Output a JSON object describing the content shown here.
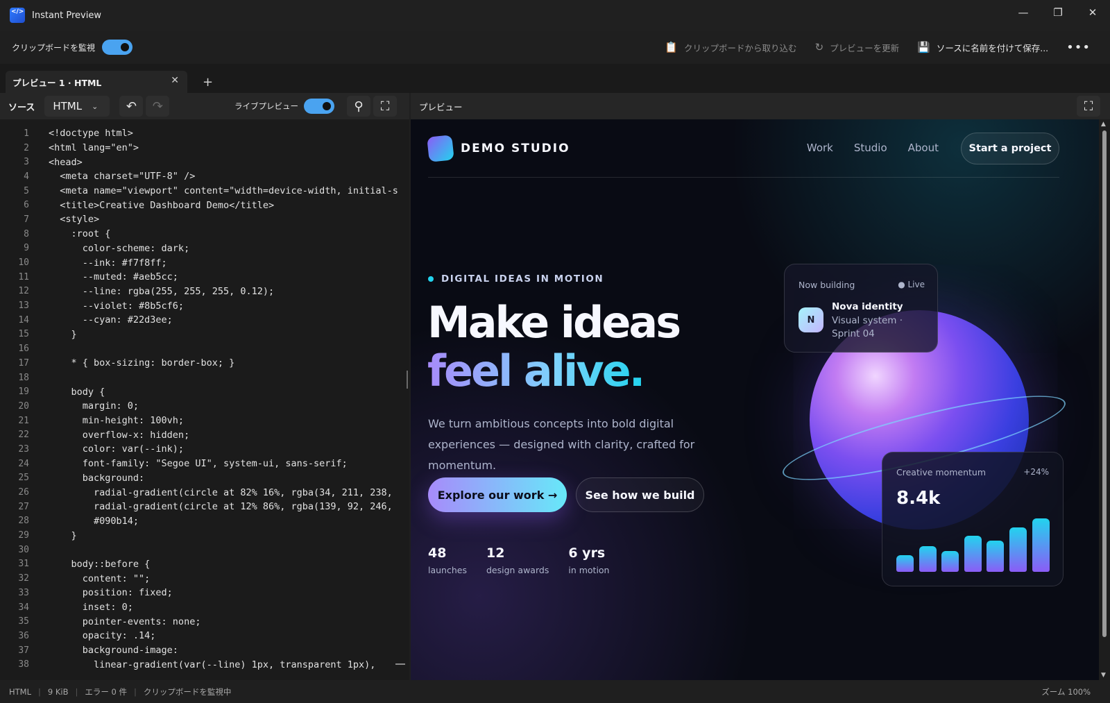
{
  "window": {
    "title": "Instant Preview",
    "controls": [
      "minimize-icon",
      "restore-icon",
      "close-icon"
    ]
  },
  "toolbar": {
    "monitor_label": "クリップボードを監視",
    "monitor_on": true,
    "import_label": "クリップボードから取り込む",
    "refresh_label": "プレビューを更新",
    "save_label": "ソースに名前を付けて保存..."
  },
  "tabs": [
    {
      "label": "プレビュー 1 · HTML",
      "active": true
    }
  ],
  "editor": {
    "source_label": "ソース",
    "language": "HTML",
    "live_preview_label": "ライブプレビュー",
    "live_preview_on": true,
    "lines": [
      {
        "n": "1",
        "text": "<!doctype html>"
      },
      {
        "n": "2",
        "text": "<html lang=\"en\">"
      },
      {
        "n": "3",
        "text": "<head>"
      },
      {
        "n": "4",
        "text": "  <meta charset=\"UTF-8\" />"
      },
      {
        "n": "5",
        "text": "  <meta name=\"viewport\" content=\"width=device-width, initial-s"
      },
      {
        "n": "6",
        "text": "  <title>Creative Dashboard Demo</title>"
      },
      {
        "n": "7",
        "text": "  <style>"
      },
      {
        "n": "8",
        "text": "    :root {"
      },
      {
        "n": "9",
        "text": "      color-scheme: dark;"
      },
      {
        "n": "10",
        "text": "      --ink: #f7f8ff;"
      },
      {
        "n": "11",
        "text": "      --muted: #aeb5cc;"
      },
      {
        "n": "12",
        "text": "      --line: rgba(255, 255, 255, 0.12);"
      },
      {
        "n": "13",
        "text": "      --violet: #8b5cf6;"
      },
      {
        "n": "14",
        "text": "      --cyan: #22d3ee;"
      },
      {
        "n": "15",
        "text": "    }"
      },
      {
        "n": "16",
        "text": ""
      },
      {
        "n": "17",
        "text": "    * { box-sizing: border-box; }"
      },
      {
        "n": "18",
        "text": ""
      },
      {
        "n": "19",
        "text": "    body {"
      },
      {
        "n": "20",
        "text": "      margin: 0;"
      },
      {
        "n": "21",
        "text": "      min-height: 100vh;"
      },
      {
        "n": "22",
        "text": "      overflow-x: hidden;"
      },
      {
        "n": "23",
        "text": "      color: var(--ink);"
      },
      {
        "n": "24",
        "text": "      font-family: \"Segoe UI\", system-ui, sans-serif;"
      },
      {
        "n": "25",
        "text": "      background:"
      },
      {
        "n": "26",
        "text": "        radial-gradient(circle at 82% 16%, rgba(34, 211, 238,"
      },
      {
        "n": "27",
        "text": "        radial-gradient(circle at 12% 86%, rgba(139, 92, 246,"
      },
      {
        "n": "28",
        "text": "        #090b14;"
      },
      {
        "n": "29",
        "text": "    }"
      },
      {
        "n": "30",
        "text": ""
      },
      {
        "n": "31",
        "text": "    body::before {"
      },
      {
        "n": "32",
        "text": "      content: \"\";"
      },
      {
        "n": "33",
        "text": "      position: fixed;"
      },
      {
        "n": "34",
        "text": "      inset: 0;"
      },
      {
        "n": "35",
        "text": "      pointer-events: none;"
      },
      {
        "n": "36",
        "text": "      opacity: .14;"
      },
      {
        "n": "37",
        "text": "      background-image:"
      },
      {
        "n": "38",
        "text": "        linear-gradient(var(--line) 1px, transparent 1px),"
      }
    ]
  },
  "preview": {
    "label": "プレビュー",
    "site": {
      "brand": "DEMO STUDIO",
      "nav": [
        "Work",
        "Studio",
        "About"
      ],
      "cta": "Start a project",
      "eyebrow": "DIGITAL IDEAS IN MOTION",
      "headline_1": "Make ideas",
      "headline_2": "feel alive.",
      "lead": "We turn ambitious concepts into bold digital experiences — designed with clarity, crafted for momentum.",
      "btn_primary": "Explore our work →",
      "btn_secondary": "See how we build",
      "stats": [
        {
          "value": "48",
          "label": "launches"
        },
        {
          "value": "12",
          "label": "design awards"
        },
        {
          "value": "6 yrs",
          "label": "in motion"
        }
      ],
      "now_card": {
        "title": "Now building",
        "status": "● Live",
        "avatar": "N",
        "name": "Nova identity",
        "sub": "Visual system · Sprint 04"
      },
      "momentum_card": {
        "title": "Creative momentum",
        "delta": "+24%",
        "value": "8.4k",
        "bars": [
          0.28,
          0.44,
          0.36,
          0.62,
          0.53,
          0.76,
          0.92
        ]
      }
    }
  },
  "status_bar": {
    "language": "HTML",
    "size": "9 KiB",
    "errors": "エラー 0 件",
    "clipboard": "クリップボードを監視中",
    "zoom": "ズーム 100%"
  },
  "colors": {
    "accent": "#4aa3f0",
    "ink": "#f7f8ff",
    "muted": "#aeb5cc",
    "violet": "#8b5cf6",
    "cyan": "#22d3ee",
    "site_bg": "#090b14"
  }
}
